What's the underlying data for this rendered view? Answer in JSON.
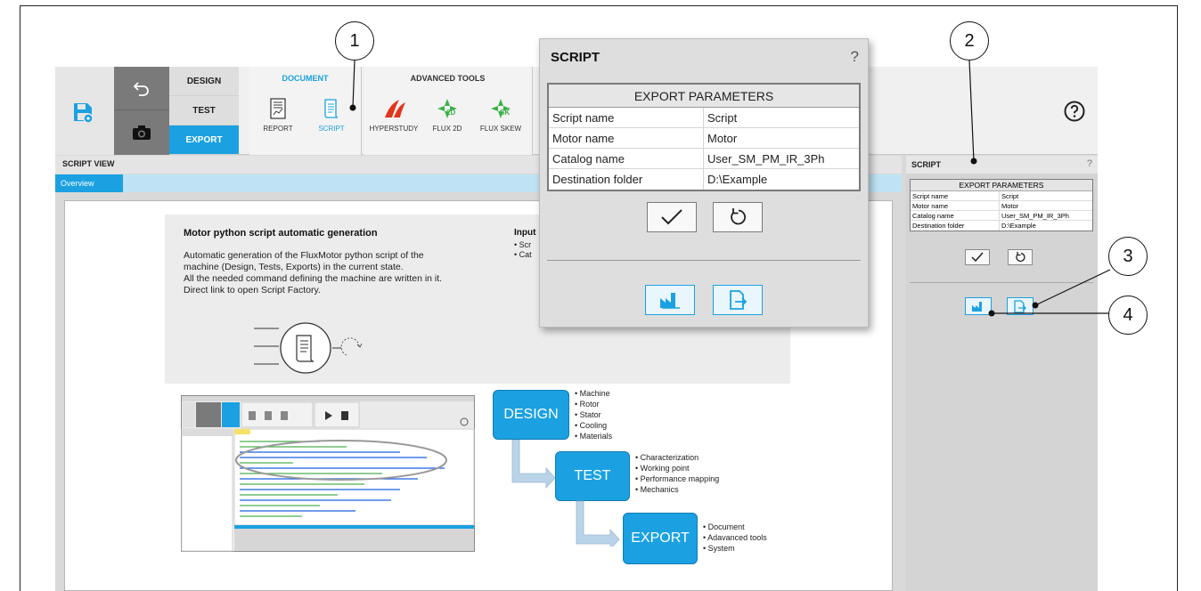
{
  "ribbon": {
    "nav": [
      "DESIGN",
      "TEST",
      "EXPORT"
    ],
    "document_group": {
      "title": "DOCUMENT",
      "tools": [
        "REPORT",
        "SCRIPT"
      ]
    },
    "advanced_group": {
      "title": "ADVANCED TOOLS",
      "tools": [
        "HYPERSTUDY",
        "FLUX 2D",
        "FLUX SKEW"
      ]
    }
  },
  "script_view": {
    "header": "SCRIPT VIEW",
    "tab": "Overview",
    "info": {
      "title": "Motor python script automatic generation",
      "lines": [
        "Automatic generation of the FluxMotor python script of the",
        "machine (Design, Tests, Exports) in the current state.",
        "All the needed command defining the machine are written in it.",
        "Direct link to open Script Factory."
      ],
      "inputs_title": "Input",
      "inputs_bullets": [
        "• Scr",
        "• Cat"
      ]
    },
    "flow": {
      "design": {
        "label": "DESIGN",
        "items": [
          "Machine",
          "Rotor",
          "Stator",
          "Cooling",
          "Materials"
        ]
      },
      "test": {
        "label": "TEST",
        "items": [
          "Characterization",
          "Working point",
          "Performance mapping",
          "Mechanics"
        ]
      },
      "export": {
        "label": "EXPORT",
        "items": [
          "Document",
          "Adavanced tools",
          "System"
        ]
      }
    }
  },
  "export_parameters": {
    "caption": "EXPORT PARAMETERS",
    "rows": [
      {
        "key": "Script name",
        "value": "Script"
      },
      {
        "key": "Motor name",
        "value": "Motor"
      },
      {
        "key": "Catalog name",
        "value": "User_SM_PM_IR_3Ph"
      },
      {
        "key": "Destination folder",
        "value": "D:\\Example"
      }
    ]
  },
  "popup": {
    "title": "SCRIPT",
    "help": "?"
  },
  "right_panel": {
    "title": "SCRIPT",
    "help": "?"
  },
  "callouts": [
    "1",
    "2",
    "3",
    "4"
  ],
  "colors": {
    "accent": "#1ba1e2",
    "panel": "#d9d9d9",
    "dark": "#7a7a7a"
  }
}
